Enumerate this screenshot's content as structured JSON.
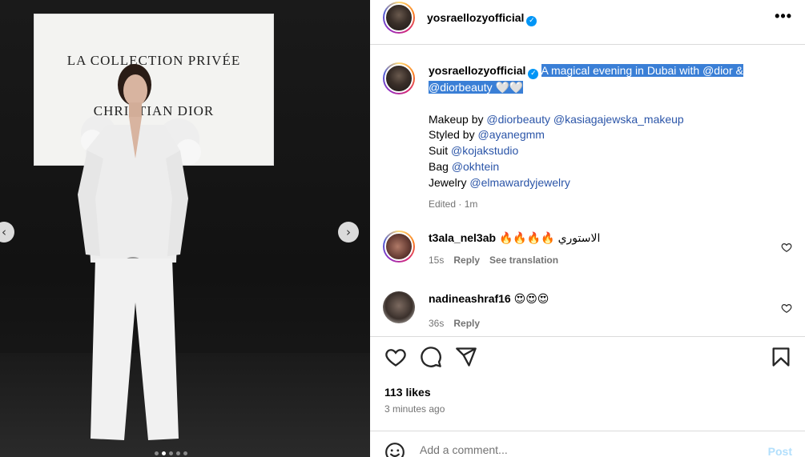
{
  "media": {
    "sign_line1": "LA COLLECTION PRIVÉE",
    "sign_line2": "CHRISTIAN DIOR",
    "prev_glyph": "‹",
    "next_glyph": "›",
    "slide_count": 5,
    "active_slide": 1
  },
  "header": {
    "username": "yosraellozyofficial",
    "verified_glyph": "✓",
    "more_glyph": "•••"
  },
  "caption": {
    "username": "yosraellozyofficial",
    "text": "A magical evening in Dubai with @dior & @diorbeauty 🤍🤍",
    "credits": [
      {
        "label": "Makeup by",
        "mentions": [
          "@diorbeauty",
          "@kasiagajewska_makeup"
        ]
      },
      {
        "label": "Styled by",
        "mentions": [
          "@ayanegmm"
        ]
      },
      {
        "label": "Suit",
        "mentions": [
          "@kojakstudio"
        ]
      },
      {
        "label": "Bag",
        "mentions": [
          "@okhtein"
        ]
      },
      {
        "label": "Jewelry",
        "mentions": [
          "@elmawardyjewelry"
        ]
      }
    ],
    "edited": "Edited · 1m"
  },
  "comments": [
    {
      "username": "t3ala_nel3ab",
      "text": "🔥🔥🔥🔥 الاستوري",
      "time": "15s",
      "reply": "Reply",
      "translate": "See translation"
    },
    {
      "username": "nadineashraf16",
      "text": "😍😍😍",
      "time": "36s",
      "reply": "Reply"
    }
  ],
  "footer": {
    "likes": "113 likes",
    "time": "3 minutes ago",
    "comment_placeholder": "Add a comment...",
    "post_label": "Post"
  },
  "icons": [
    "heart-icon",
    "comment-icon",
    "share-icon",
    "bookmark-icon",
    "emoji-icon",
    "verified-icon",
    "more-icon"
  ],
  "colors": {
    "link": "#2b55a8",
    "highlight": "#3a7fd6",
    "verified": "#0095f6",
    "post_disabled": "#b2dffc",
    "muted": "#737373"
  }
}
